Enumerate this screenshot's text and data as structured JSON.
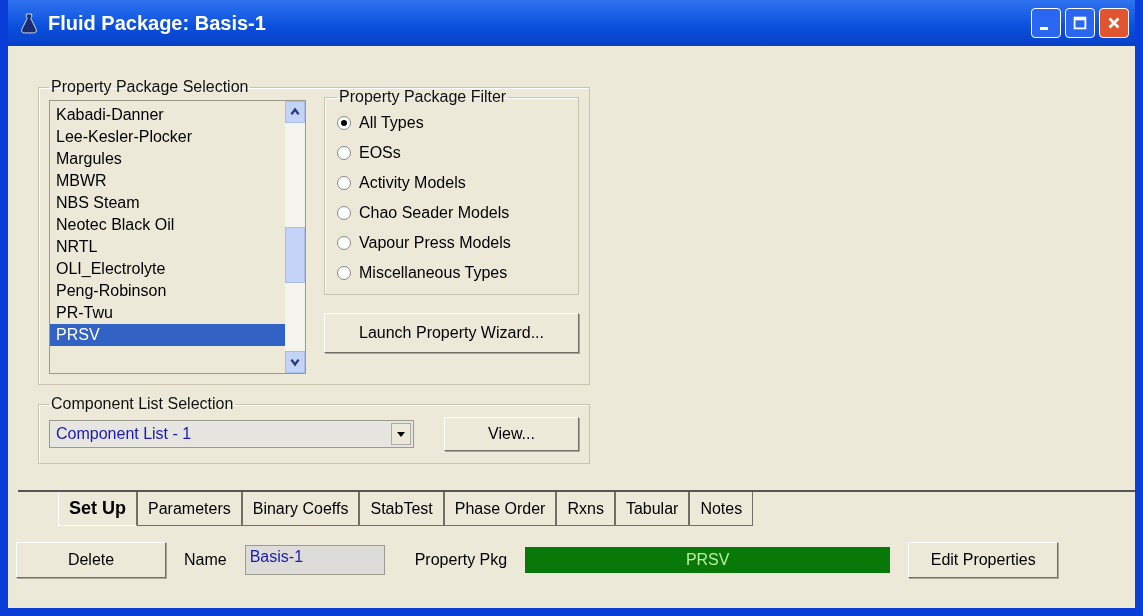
{
  "window": {
    "title": "Fluid Package: Basis-1"
  },
  "property_package_selection": {
    "title": "Property Package Selection",
    "packages": [
      {
        "label": "Kabadi-Danner",
        "selected": false
      },
      {
        "label": "Lee-Kesler-Plocker",
        "selected": false
      },
      {
        "label": "Margules",
        "selected": false
      },
      {
        "label": "MBWR",
        "selected": false
      },
      {
        "label": "NBS Steam",
        "selected": false
      },
      {
        "label": "Neotec Black Oil",
        "selected": false
      },
      {
        "label": "NRTL",
        "selected": false
      },
      {
        "label": "OLI_Electrolyte",
        "selected": false
      },
      {
        "label": "Peng-Robinson",
        "selected": false
      },
      {
        "label": "PR-Twu",
        "selected": false
      },
      {
        "label": "PRSV",
        "selected": true
      }
    ],
    "filter": {
      "title": "Property Package Filter",
      "options": [
        {
          "label": "All Types",
          "selected": true
        },
        {
          "label": "EOSs",
          "selected": false
        },
        {
          "label": "Activity Models",
          "selected": false
        },
        {
          "label": "Chao Seader Models",
          "selected": false
        },
        {
          "label": "Vapour Press Models",
          "selected": false
        },
        {
          "label": "Miscellaneous Types",
          "selected": false
        }
      ]
    },
    "wizard_button": "Launch Property Wizard..."
  },
  "component_list_selection": {
    "title": "Component List Selection",
    "value": "Component List - 1",
    "view_button": "View..."
  },
  "tabs": [
    {
      "label": "Set Up",
      "selected": true
    },
    {
      "label": "Parameters",
      "selected": false
    },
    {
      "label": "Binary Coeffs",
      "selected": false
    },
    {
      "label": "StabTest",
      "selected": false
    },
    {
      "label": "Phase Order",
      "selected": false
    },
    {
      "label": "Rxns",
      "selected": false
    },
    {
      "label": "Tabular",
      "selected": false
    },
    {
      "label": "Notes",
      "selected": false
    }
  ],
  "footer": {
    "delete_button": "Delete",
    "name_label": "Name",
    "name_value": "Basis-1",
    "property_pkg_label": "Property Pkg",
    "property_pkg_value": "PRSV",
    "edit_button": "Edit Properties"
  }
}
